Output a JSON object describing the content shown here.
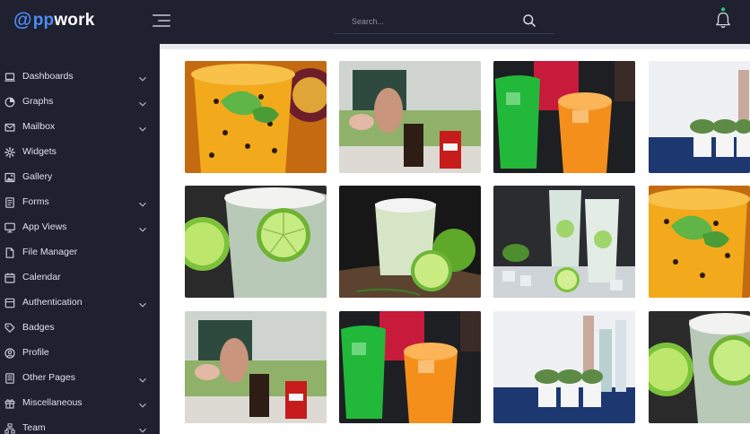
{
  "brand": {
    "at": "@",
    "pp": "pp",
    "rest": "work"
  },
  "search": {
    "placeholder": "Search..."
  },
  "colors": {
    "topbar": "#1f2030",
    "sidebar": "#1f2030",
    "accent": "#4f8cf5",
    "notification_dot": "#27c26b"
  },
  "sidebar": {
    "items": [
      {
        "label": "Dashboards",
        "icon": "laptop-icon",
        "has_submenu": true
      },
      {
        "label": "Graphs",
        "icon": "pie-chart-icon",
        "has_submenu": true
      },
      {
        "label": "Mailbox",
        "icon": "mail-icon",
        "has_submenu": true
      },
      {
        "label": "Widgets",
        "icon": "gear-icon",
        "has_submenu": false
      },
      {
        "label": "Gallery",
        "icon": "image-icon",
        "has_submenu": false
      },
      {
        "label": "Forms",
        "icon": "form-icon",
        "has_submenu": true
      },
      {
        "label": "App Views",
        "icon": "monitor-icon",
        "has_submenu": true
      },
      {
        "label": "File Manager",
        "icon": "file-icon",
        "has_submenu": false
      },
      {
        "label": "Calendar",
        "icon": "calendar-icon",
        "has_submenu": false
      },
      {
        "label": "Authentication",
        "icon": "lock-icon",
        "has_submenu": true
      },
      {
        "label": "Badges",
        "icon": "badge-icon",
        "has_submenu": false
      },
      {
        "label": "Profile",
        "icon": "profile-icon",
        "has_submenu": false
      },
      {
        "label": "Other Pages",
        "icon": "pages-icon",
        "has_submenu": true
      },
      {
        "label": "Miscellaneous",
        "icon": "gift-icon",
        "has_submenu": true
      },
      {
        "label": "Team",
        "icon": "team-icon",
        "has_submenu": true
      }
    ]
  },
  "gallery": {
    "images": [
      {
        "subject": "passion-fruit-drink"
      },
      {
        "subject": "picnic-cola"
      },
      {
        "subject": "colorful-drinks"
      },
      {
        "subject": "bottles-herbs"
      },
      {
        "subject": "lime-glass"
      },
      {
        "subject": "lime-cocktail"
      },
      {
        "subject": "ice-drinks"
      },
      {
        "subject": "passion-fruit-drink"
      },
      {
        "subject": "picnic-cola"
      },
      {
        "subject": "colorful-drinks"
      },
      {
        "subject": "bottles-herbs"
      },
      {
        "subject": "lime-glass"
      }
    ]
  }
}
